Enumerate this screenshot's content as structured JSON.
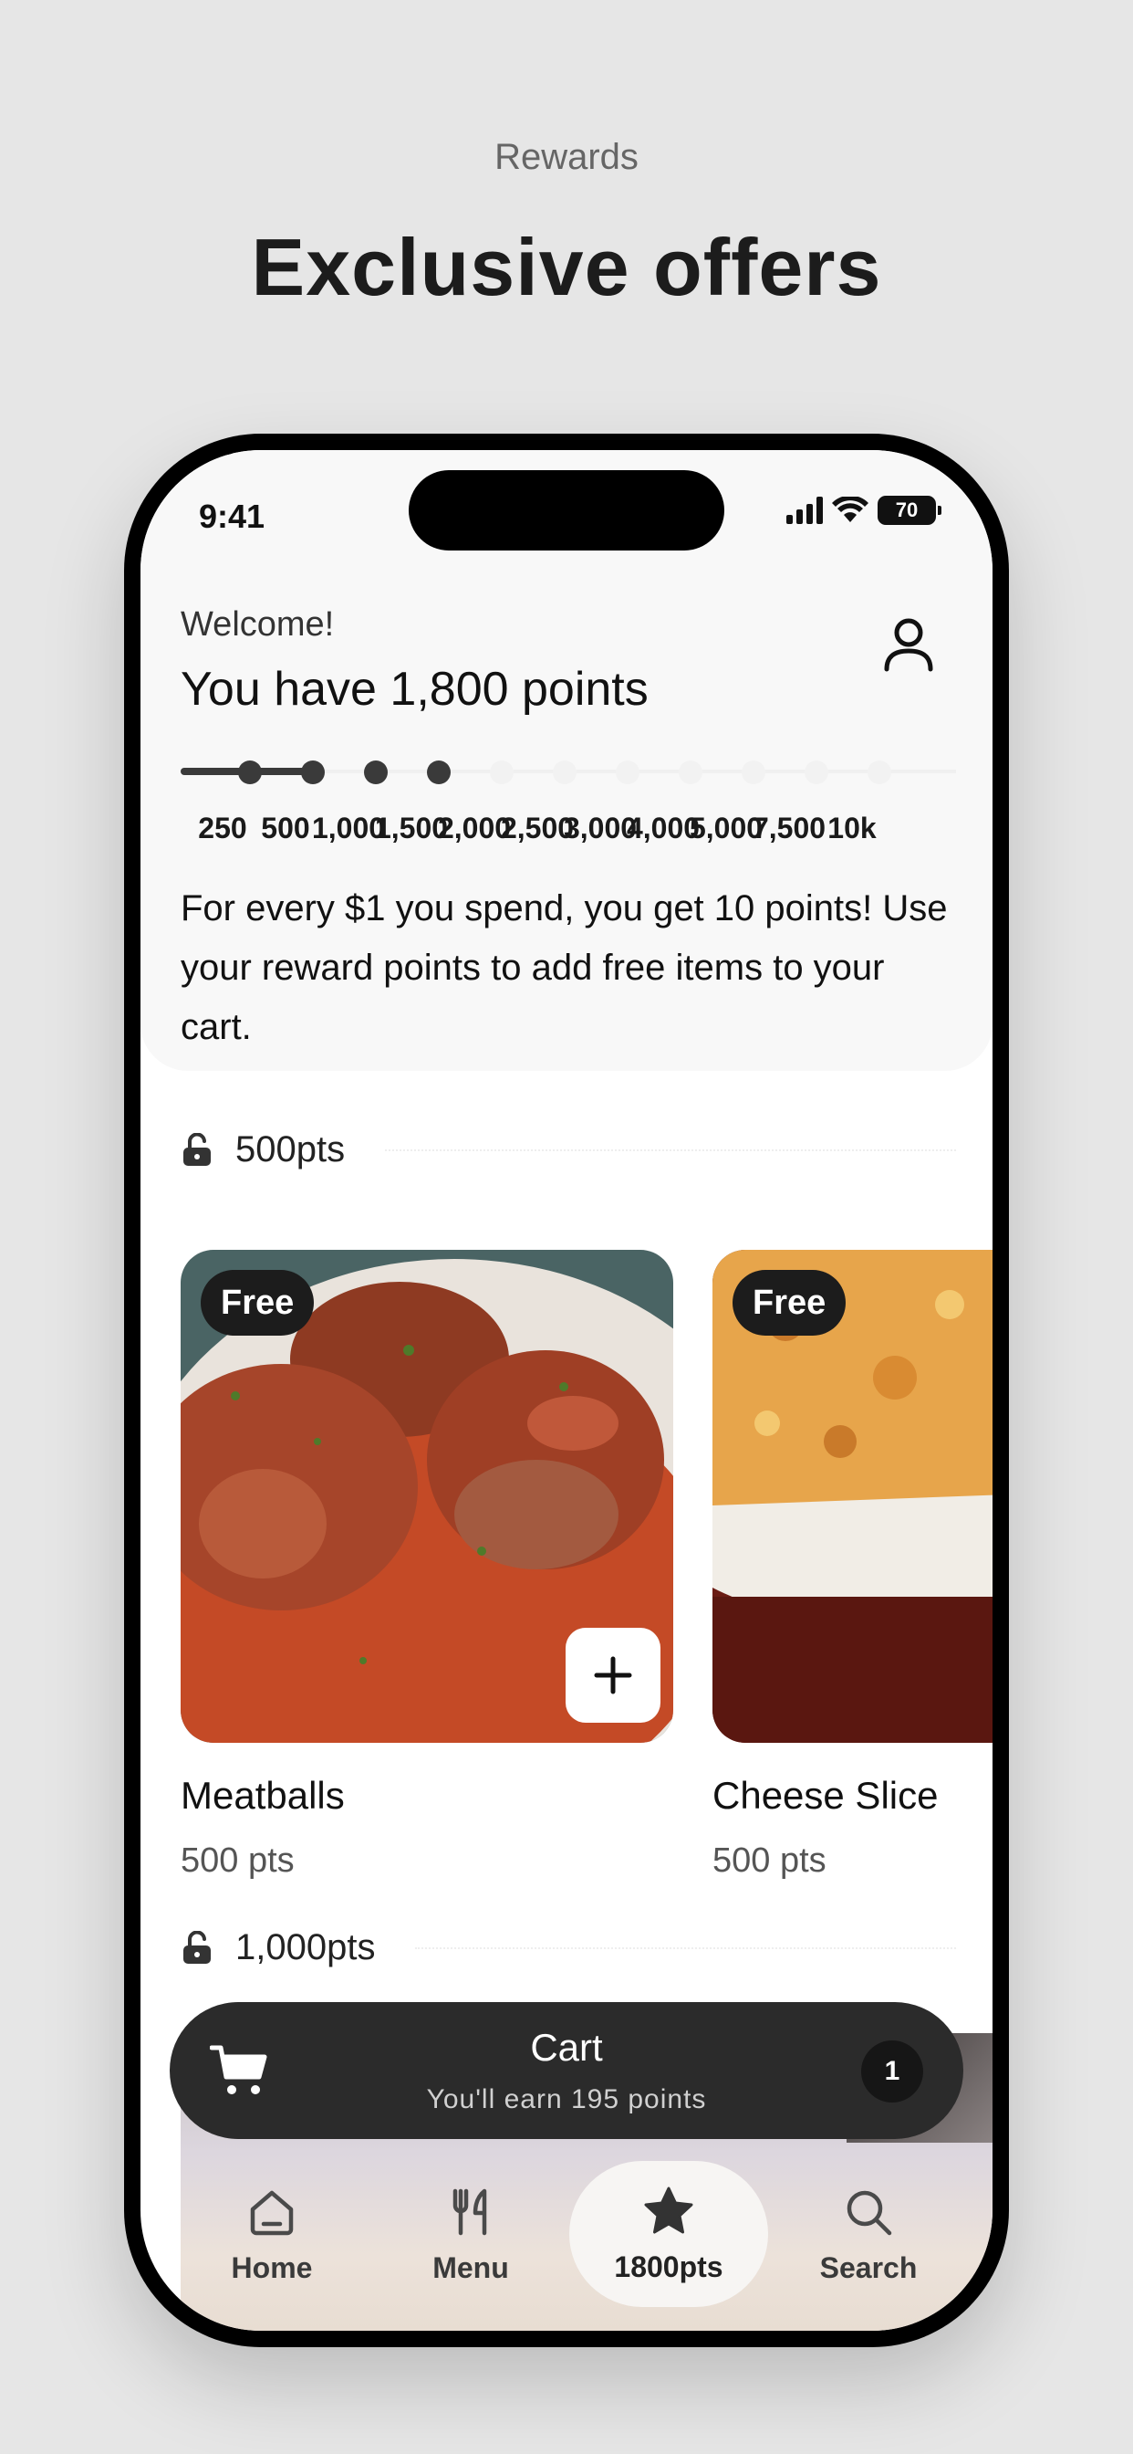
{
  "promo": {
    "kicker": "Rewards",
    "title": "Exclusive offers"
  },
  "status_bar": {
    "time": "9:41",
    "battery": "70"
  },
  "header": {
    "welcome": "Welcome!",
    "points_title": "You have 1,800 points",
    "tiers": [
      "250",
      "500",
      "1,000",
      "1,500",
      "2,000",
      "2,500",
      "3,000",
      "4,000",
      "5,000",
      "7,500",
      "10k"
    ],
    "achieved_tiers_count": 4,
    "info": "For every $1 you spend, you get 10 points! Use your reward points to add free items to your cart."
  },
  "sections": [
    {
      "label": "500pts",
      "items": [
        {
          "badge": "Free",
          "name": "Meatballs",
          "pts": "500 pts",
          "image_icon": "meatballs-photo"
        },
        {
          "badge": "Free",
          "name": "Cheese Slice",
          "pts": "500 pts",
          "image_icon": "cheese-slice-photo"
        }
      ]
    },
    {
      "label": "1,000pts"
    }
  ],
  "cart": {
    "title": "Cart",
    "subtitle": "You'll earn 195 points",
    "count": "1"
  },
  "tabs": [
    {
      "label": "Home",
      "icon": "home-icon"
    },
    {
      "label": "Menu",
      "icon": "utensils-icon"
    },
    {
      "label": "1800pts",
      "icon": "star-icon",
      "active": true
    },
    {
      "label": "Search",
      "icon": "search-icon"
    }
  ],
  "colors": {
    "dark": "#2b2b2b",
    "background": "#e6e6e6",
    "accent_sauce": "#b5432a"
  }
}
